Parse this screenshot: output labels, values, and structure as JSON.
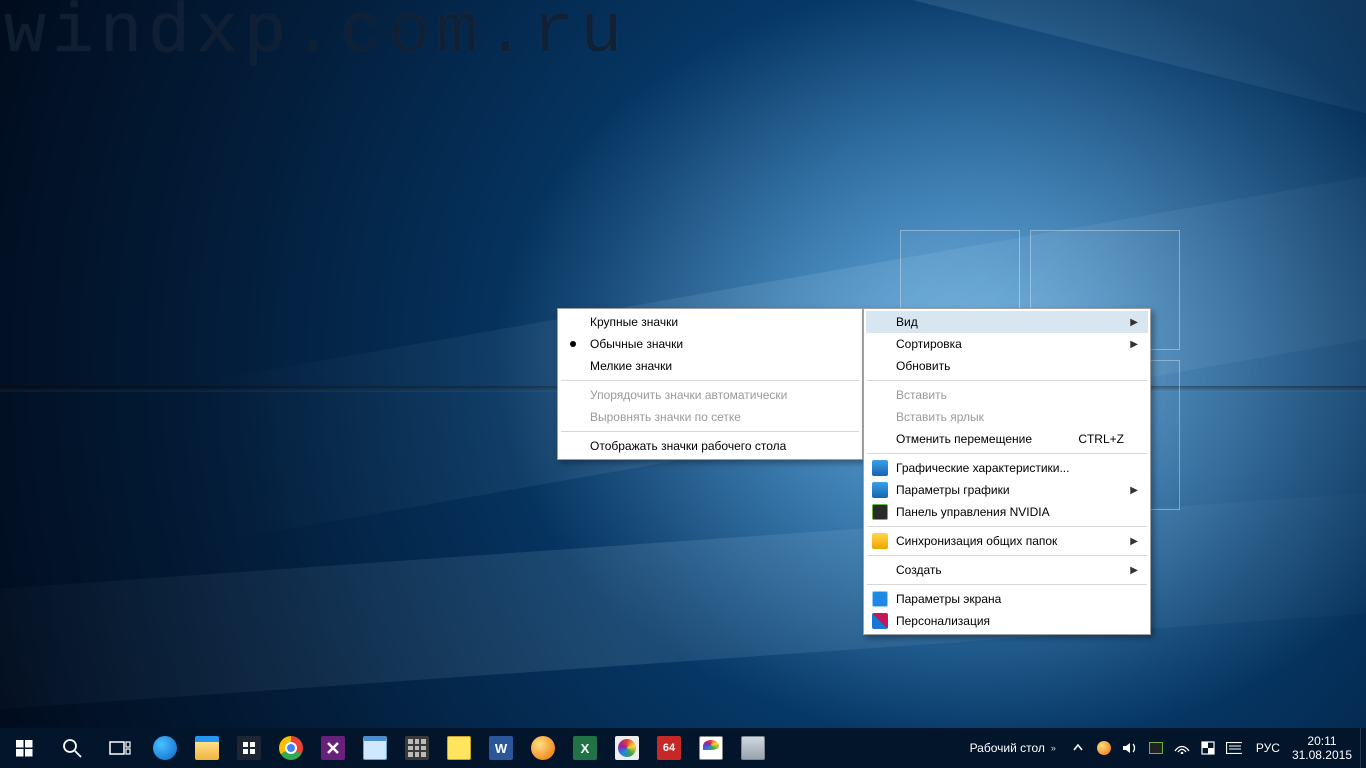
{
  "watermark": "windxp.com.ru",
  "submenu": {
    "items": [
      {
        "label": "Крупные значки",
        "checked": false
      },
      {
        "label": "Обычные значки",
        "checked": true
      },
      {
        "label": "Мелкие значки",
        "checked": false
      }
    ],
    "auto_arrange": "Упорядочить значки автоматически",
    "align_grid": "Выровнять значки по сетке",
    "show_icons": "Отображать значки рабочего стола"
  },
  "context": {
    "view": "Вид",
    "sort": "Сортировка",
    "refresh": "Обновить",
    "paste": "Вставить",
    "paste_shortcut": "Вставить ярлык",
    "undo_move": "Отменить перемещение",
    "undo_hotkey": "CTRL+Z",
    "gfx_props": "Графические характеристики...",
    "gfx_params": "Параметры графики",
    "nvidia_cp": "Панель управления NVIDIA",
    "sync_shared": "Синхронизация общих папок",
    "new": "Создать",
    "display_settings": "Параметры экрана",
    "personalize": "Персонализация"
  },
  "taskbar": {
    "toolbar_label": "Рабочий стол",
    "lang": "РУС",
    "time": "20:11",
    "date": "31.08.2015"
  }
}
